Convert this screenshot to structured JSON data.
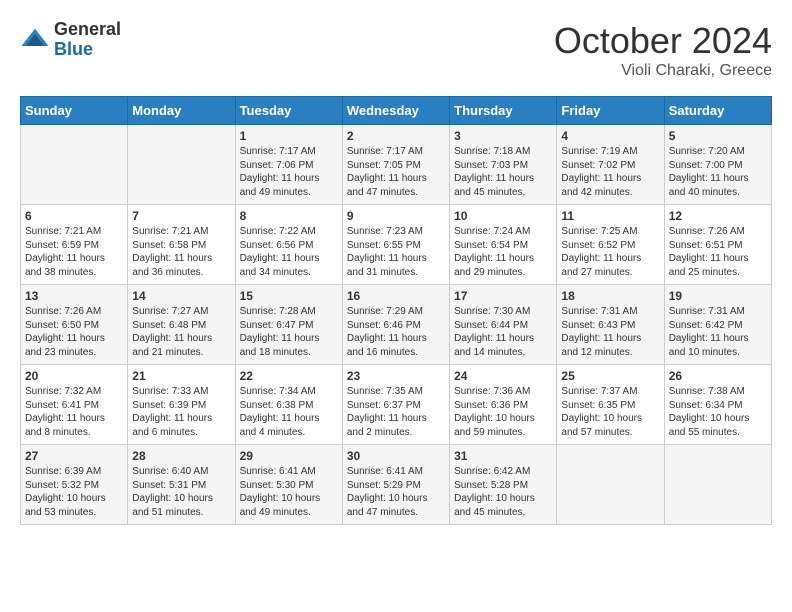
{
  "logo": {
    "general": "General",
    "blue": "Blue"
  },
  "header": {
    "month": "October 2024",
    "location": "Violi Charaki, Greece"
  },
  "days_of_week": [
    "Sunday",
    "Monday",
    "Tuesday",
    "Wednesday",
    "Thursday",
    "Friday",
    "Saturday"
  ],
  "weeks": [
    [
      {
        "day": null,
        "info": null
      },
      {
        "day": null,
        "info": null
      },
      {
        "day": "1",
        "info": "Sunrise: 7:17 AM\nSunset: 7:06 PM\nDaylight: 11 hours and 49 minutes."
      },
      {
        "day": "2",
        "info": "Sunrise: 7:17 AM\nSunset: 7:05 PM\nDaylight: 11 hours and 47 minutes."
      },
      {
        "day": "3",
        "info": "Sunrise: 7:18 AM\nSunset: 7:03 PM\nDaylight: 11 hours and 45 minutes."
      },
      {
        "day": "4",
        "info": "Sunrise: 7:19 AM\nSunset: 7:02 PM\nDaylight: 11 hours and 42 minutes."
      },
      {
        "day": "5",
        "info": "Sunrise: 7:20 AM\nSunset: 7:00 PM\nDaylight: 11 hours and 40 minutes."
      }
    ],
    [
      {
        "day": "6",
        "info": "Sunrise: 7:21 AM\nSunset: 6:59 PM\nDaylight: 11 hours and 38 minutes."
      },
      {
        "day": "7",
        "info": "Sunrise: 7:21 AM\nSunset: 6:58 PM\nDaylight: 11 hours and 36 minutes."
      },
      {
        "day": "8",
        "info": "Sunrise: 7:22 AM\nSunset: 6:56 PM\nDaylight: 11 hours and 34 minutes."
      },
      {
        "day": "9",
        "info": "Sunrise: 7:23 AM\nSunset: 6:55 PM\nDaylight: 11 hours and 31 minutes."
      },
      {
        "day": "10",
        "info": "Sunrise: 7:24 AM\nSunset: 6:54 PM\nDaylight: 11 hours and 29 minutes."
      },
      {
        "day": "11",
        "info": "Sunrise: 7:25 AM\nSunset: 6:52 PM\nDaylight: 11 hours and 27 minutes."
      },
      {
        "day": "12",
        "info": "Sunrise: 7:26 AM\nSunset: 6:51 PM\nDaylight: 11 hours and 25 minutes."
      }
    ],
    [
      {
        "day": "13",
        "info": "Sunrise: 7:26 AM\nSunset: 6:50 PM\nDaylight: 11 hours and 23 minutes."
      },
      {
        "day": "14",
        "info": "Sunrise: 7:27 AM\nSunset: 6:48 PM\nDaylight: 11 hours and 21 minutes."
      },
      {
        "day": "15",
        "info": "Sunrise: 7:28 AM\nSunset: 6:47 PM\nDaylight: 11 hours and 18 minutes."
      },
      {
        "day": "16",
        "info": "Sunrise: 7:29 AM\nSunset: 6:46 PM\nDaylight: 11 hours and 16 minutes."
      },
      {
        "day": "17",
        "info": "Sunrise: 7:30 AM\nSunset: 6:44 PM\nDaylight: 11 hours and 14 minutes."
      },
      {
        "day": "18",
        "info": "Sunrise: 7:31 AM\nSunset: 6:43 PM\nDaylight: 11 hours and 12 minutes."
      },
      {
        "day": "19",
        "info": "Sunrise: 7:31 AM\nSunset: 6:42 PM\nDaylight: 11 hours and 10 minutes."
      }
    ],
    [
      {
        "day": "20",
        "info": "Sunrise: 7:32 AM\nSunset: 6:41 PM\nDaylight: 11 hours and 8 minutes."
      },
      {
        "day": "21",
        "info": "Sunrise: 7:33 AM\nSunset: 6:39 PM\nDaylight: 11 hours and 6 minutes."
      },
      {
        "day": "22",
        "info": "Sunrise: 7:34 AM\nSunset: 6:38 PM\nDaylight: 11 hours and 4 minutes."
      },
      {
        "day": "23",
        "info": "Sunrise: 7:35 AM\nSunset: 6:37 PM\nDaylight: 11 hours and 2 minutes."
      },
      {
        "day": "24",
        "info": "Sunrise: 7:36 AM\nSunset: 6:36 PM\nDaylight: 10 hours and 59 minutes."
      },
      {
        "day": "25",
        "info": "Sunrise: 7:37 AM\nSunset: 6:35 PM\nDaylight: 10 hours and 57 minutes."
      },
      {
        "day": "26",
        "info": "Sunrise: 7:38 AM\nSunset: 6:34 PM\nDaylight: 10 hours and 55 minutes."
      }
    ],
    [
      {
        "day": "27",
        "info": "Sunrise: 6:39 AM\nSunset: 5:32 PM\nDaylight: 10 hours and 53 minutes."
      },
      {
        "day": "28",
        "info": "Sunrise: 6:40 AM\nSunset: 5:31 PM\nDaylight: 10 hours and 51 minutes."
      },
      {
        "day": "29",
        "info": "Sunrise: 6:41 AM\nSunset: 5:30 PM\nDaylight: 10 hours and 49 minutes."
      },
      {
        "day": "30",
        "info": "Sunrise: 6:41 AM\nSunset: 5:29 PM\nDaylight: 10 hours and 47 minutes."
      },
      {
        "day": "31",
        "info": "Sunrise: 6:42 AM\nSunset: 5:28 PM\nDaylight: 10 hours and 45 minutes."
      },
      {
        "day": null,
        "info": null
      },
      {
        "day": null,
        "info": null
      }
    ]
  ]
}
